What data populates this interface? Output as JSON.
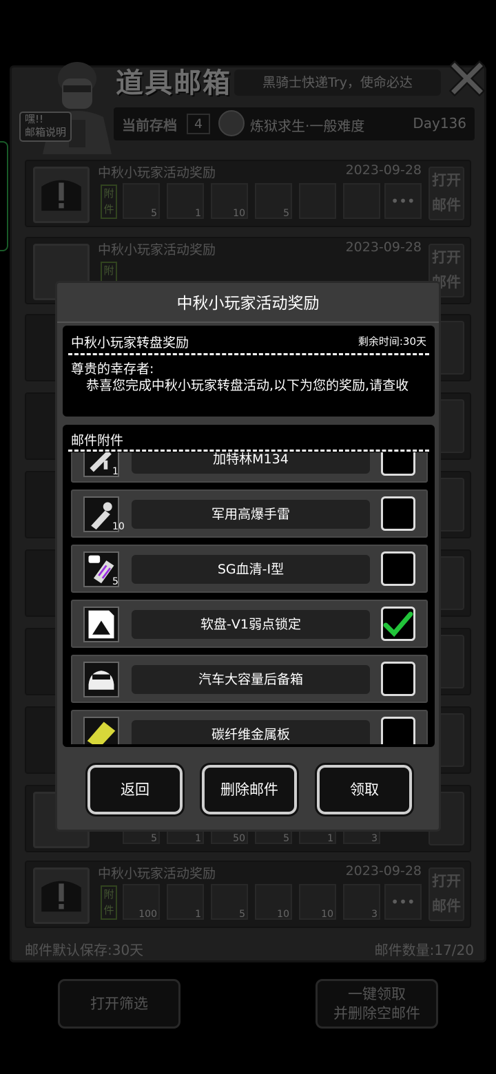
{
  "header": {
    "title": "道具邮箱",
    "slogan": "黑骑士快递Try，使命必达",
    "help_badge": "嘿!!\n邮箱说明",
    "save_label": "当前存档",
    "save_slot": "4",
    "save_name": "炼狱求生·一般难度",
    "save_day": "Day136"
  },
  "mail_list": {
    "items": [
      {
        "title": "中秋小玩家活动奖励",
        "date": "2023-09-28",
        "attach_label": "附件",
        "open_label": "打开邮件",
        "slots": [
          {
            "qty": "5"
          },
          {
            "qty": "1"
          },
          {
            "qty": "10"
          },
          {
            "qty": "5"
          },
          {
            "qty": ""
          },
          {
            "qty": ""
          }
        ]
      },
      {
        "title": "中秋小玩家活动奖励",
        "date": "2023-09-28",
        "attach_label": "附件",
        "open_label": "打开邮件",
        "slots": []
      },
      {
        "title": "中秋小玩家活动奖励",
        "date": "2023-09-28",
        "attach_label": "附件",
        "open_label": "打开邮件",
        "slots": [
          {
            "qty": "100"
          },
          {
            "qty": "1"
          },
          {
            "qty": "5"
          },
          {
            "qty": "10"
          },
          {
            "qty": "10"
          },
          {
            "qty": "3"
          }
        ]
      }
    ],
    "partial_qtys": [
      "5",
      "1",
      "50",
      "5",
      "1",
      "3"
    ],
    "more_label": "•••"
  },
  "footer": {
    "retention": "邮件默认保存:30天",
    "count": "邮件数量:17/20",
    "filter_button": "打开筛选",
    "claim_all_button": "一键领取\n并删除空邮件"
  },
  "modal": {
    "title": "中秋小玩家活动奖励",
    "subject": "中秋小玩家转盘奖励",
    "remaining": "剩余时间:30天",
    "greeting": "尊贵的幸存者:",
    "body": "恭喜您完成中秋小玩家转盘活动,以下为您的奖励,请查收",
    "attach_header": "邮件附件",
    "attachments": [
      {
        "name": "加特林M134",
        "qty": "1",
        "checked": false,
        "icon": "gatling-icon"
      },
      {
        "name": "军用高爆手雷",
        "qty": "10",
        "checked": false,
        "icon": "grenade-icon"
      },
      {
        "name": "SG血清-I型",
        "qty": "5",
        "checked": false,
        "icon": "serum-icon"
      },
      {
        "name": "软盘-V1弱点锁定",
        "qty": "",
        "checked": true,
        "icon": "floppy-icon"
      },
      {
        "name": "汽车大容量后备箱",
        "qty": "",
        "checked": false,
        "icon": "car-trunk-icon"
      },
      {
        "name": "碳纤维金属板",
        "qty": "",
        "checked": false,
        "icon": "carbon-plate-icon"
      }
    ],
    "buttons": {
      "back": "返回",
      "delete": "删除邮件",
      "claim": "领取"
    }
  },
  "colors": {
    "check_green": "#22c43a",
    "frame_green": "#2fa54a",
    "attach_tag": "#7a9a5a"
  }
}
